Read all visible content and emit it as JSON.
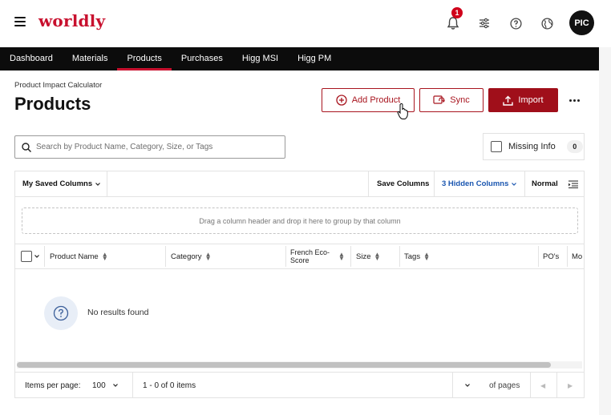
{
  "header": {
    "logo": "worldly",
    "notification_count": "1",
    "avatar_initials": "PIC"
  },
  "nav": {
    "items": [
      {
        "label": "Dashboard",
        "active": false
      },
      {
        "label": "Materials",
        "active": false
      },
      {
        "label": "Products",
        "active": true
      },
      {
        "label": "Purchases",
        "active": false
      },
      {
        "label": "Higg MSI",
        "active": false
      },
      {
        "label": "Higg PM",
        "active": false
      }
    ]
  },
  "page": {
    "subtitle": "Product Impact Calculator",
    "title": "Products"
  },
  "actions": {
    "add_product": "Add Product",
    "sync": "Sync",
    "import": "Import"
  },
  "search": {
    "placeholder": "Search by Product Name, Category, Size, or Tags",
    "value": ""
  },
  "filter": {
    "missing_info_label": "Missing Info",
    "missing_info_count": "0",
    "checked": false
  },
  "toolbar": {
    "saved_columns": "My Saved Columns",
    "save_columns": "Save Columns",
    "hidden_columns": "3 Hidden Columns",
    "density": "Normal"
  },
  "grid": {
    "group_hint": "Drag a column header and drop it here to group by that column",
    "columns": [
      "Product Name",
      "Category",
      "French Eco-Score",
      "Size",
      "Tags",
      "PO's",
      "Mo"
    ],
    "empty_message": "No results found"
  },
  "pager": {
    "items_per_page_label": "Items per page:",
    "items_per_page_value": "100",
    "range": "1 - 0 of 0 items",
    "of_pages": "of pages"
  },
  "colors": {
    "brand": "#c8102e",
    "primary_button": "#a00f1a",
    "nav_background": "#0c0c0c",
    "link": "#1a56b0"
  }
}
